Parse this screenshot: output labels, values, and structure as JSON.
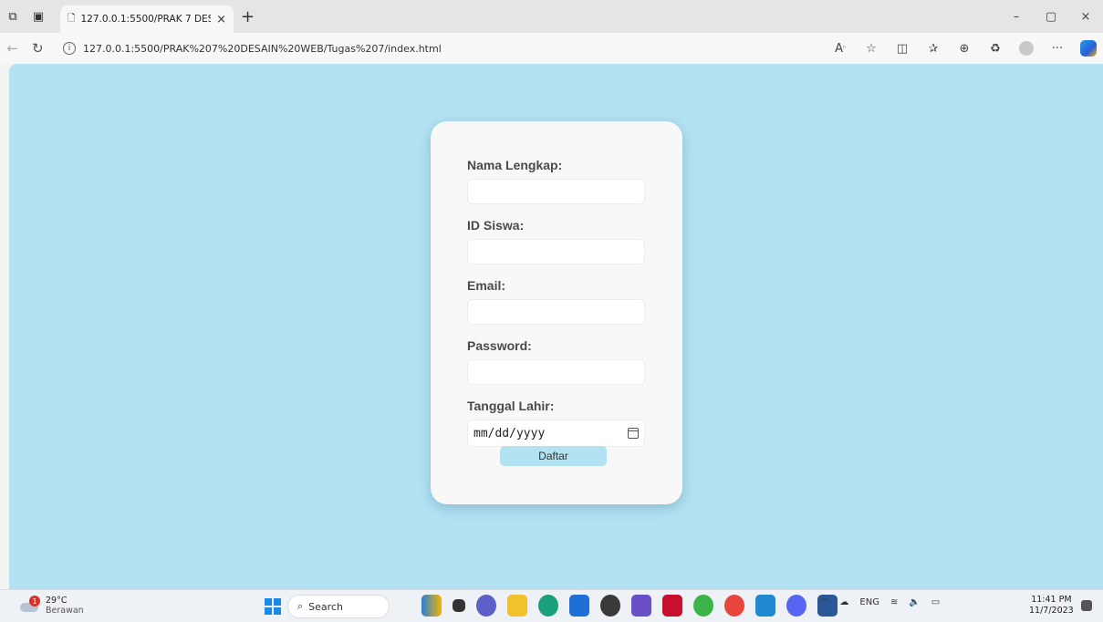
{
  "browser": {
    "tab_title": "127.0.0.1:5500/PRAK 7 DESAIN W",
    "tab_close": "×",
    "new_tab": "+",
    "url": "127.0.0.1:5500/PRAK%207%20DESAIN%20WEB/Tugas%207/index.html",
    "more": "···",
    "window_controls": [
      "–",
      "▢",
      "×"
    ]
  },
  "form": {
    "fields": [
      {
        "label": "Nama Lengkap:",
        "value": ""
      },
      {
        "label": "ID Siswa:",
        "value": ""
      },
      {
        "label": "Email:",
        "value": ""
      },
      {
        "label": "Password:",
        "value": ""
      },
      {
        "label": "Tanggal Lahir:",
        "value": "mm/dd/yyyy"
      }
    ],
    "submit_label": "Daftar"
  },
  "taskbar": {
    "weather_temp": "29°C",
    "weather_desc": "Berawan",
    "weather_badge": "1",
    "search_label": "Search",
    "tray_lang": "ENG",
    "time": "11:41 PM",
    "date": "11/7/2023"
  },
  "colors": {
    "page_bg": "#b3e3f3",
    "card_bg": "#f8f8f8",
    "button_bg": "#b3e3f3"
  }
}
